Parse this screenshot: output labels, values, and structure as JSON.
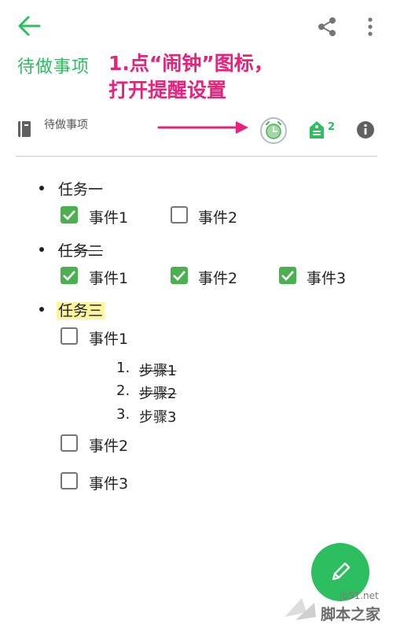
{
  "header": {
    "back_icon": "arrow-left-icon",
    "share_icon": "share-icon",
    "more_icon": "more-vert-icon",
    "accent_color": "#2dbe60"
  },
  "note": {
    "title": "待做事项",
    "notebook_name": "待做事项",
    "reminder_icon": "alarm-clock-icon",
    "tag_count": "2",
    "info_icon": "info-icon"
  },
  "annotation": {
    "line1": "1.点“闹钟”图标，",
    "line2": "打开提醒设置",
    "color": "#e8227a"
  },
  "tasks": [
    {
      "label": "任务一",
      "style": "normal",
      "items": [
        {
          "label": "事件1",
          "checked": true
        },
        {
          "label": "事件2",
          "checked": false
        }
      ]
    },
    {
      "label": "任务二",
      "style": "strikethrough",
      "items": [
        {
          "label": "事件1",
          "checked": true
        },
        {
          "label": "事件2",
          "checked": true
        },
        {
          "label": "事件3",
          "checked": true
        }
      ]
    },
    {
      "label": "任务三",
      "style": "highlight",
      "items": [
        {
          "label": "事件1",
          "checked": false
        },
        {
          "label": "事件2",
          "checked": false
        },
        {
          "label": "事件3",
          "checked": false
        }
      ],
      "steps": [
        {
          "num": "1.",
          "label": "步骤1",
          "strike": true
        },
        {
          "num": "2.",
          "label": "步骤2",
          "strike": true
        },
        {
          "num": "3.",
          "label": "步骤3",
          "strike": false
        }
      ]
    }
  ],
  "fab": {
    "icon": "pencil-icon"
  },
  "watermark": {
    "site": "jb51.net",
    "name": "脚本之家"
  }
}
